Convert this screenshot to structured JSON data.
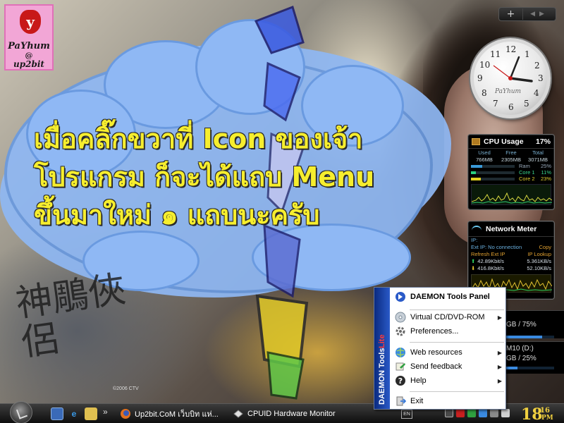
{
  "wallpaper": {
    "cloud_text_lines": [
      "เมื่อคลิ๊กขวาที่ Icon ของเจ้า",
      "โปรแกรม ก็จะได้แถบ Menu",
      "ขึ้นมาใหม่ ๑ แถบนะครับ"
    ],
    "calligraphy_text": "神鵰俠侶",
    "calligraphy_credit": "©2006 CTV",
    "corner_logo": {
      "badge": "y",
      "name": "PaYhum",
      "at": "@",
      "site": "up2bit"
    }
  },
  "sidebar": {
    "add_label": "+",
    "clock": {
      "brand": "PaYhum",
      "numbers": [
        "12",
        "1",
        "2",
        "3",
        "4",
        "5",
        "6",
        "7",
        "8",
        "9",
        "10",
        "11"
      ]
    },
    "cpu": {
      "title": "CPU Usage",
      "value": "17%",
      "col_headers": [
        "Used",
        "Free",
        "Total"
      ],
      "col_values": [
        "766MB",
        "2305MB",
        "3071MB"
      ],
      "rows": [
        {
          "label": "Ram",
          "pct": "25%",
          "fill": 0.25,
          "color": "#3a9ad8"
        },
        {
          "label": "Core 1",
          "pct": "11%",
          "fill": 0.11,
          "color": "#2ad080"
        },
        {
          "label": "Core 2",
          "pct": "23%",
          "fill": 0.23,
          "color": "#e0d020"
        }
      ]
    },
    "network": {
      "title": "Network Meter",
      "ip_label": "IP:",
      "ext_ip": "Ext IP: No connection",
      "copy": "Copy",
      "refresh": "Refresh Ext IP",
      "lookup": "IP Lookup",
      "up_left": "42.89Kbit/s",
      "up_right": "5.361KB/s",
      "down_left": "416.8Kbit/s",
      "down_right": "52.10KB/s"
    },
    "disk_frags": [
      {
        "text": "GB / 75%",
        "fill": 0.75
      },
      {
        "text": "M10 (D:)",
        "sub": "GB / 25%",
        "fill": 0.25
      }
    ]
  },
  "context_menu": {
    "strip_title": "DAEMON Tools ",
    "strip_lite": "Lite",
    "items": [
      {
        "label": "DAEMON Tools Panel",
        "icon": "daemon-icon",
        "bold": true,
        "arrow": false
      },
      {
        "label": "Virtual CD/DVD-ROM",
        "icon": "disc-icon",
        "arrow": true
      },
      {
        "label": "Preferences...",
        "icon": "gear-icon",
        "arrow": false
      },
      {
        "label": "Web resources",
        "icon": "globe-icon",
        "arrow": true
      },
      {
        "label": "Send feedback",
        "icon": "feedback-icon",
        "arrow": true
      },
      {
        "label": "Help",
        "icon": "help-icon",
        "arrow": true
      },
      {
        "label": "Exit",
        "icon": "exit-icon",
        "arrow": false
      }
    ],
    "arrow_glyph": "▶"
  },
  "taskbar": {
    "more_glyph": "»",
    "tasks": [
      {
        "label": "Up2bit.CoM เว็บบิท แห่...",
        "icon": "firefox-icon"
      },
      {
        "label": "CPUID Hardware Monitor",
        "icon": "cpuid-icon"
      }
    ],
    "lang": "EN",
    "clock_hour": "18",
    "clock_min": "16",
    "clock_ampm": "PM"
  }
}
